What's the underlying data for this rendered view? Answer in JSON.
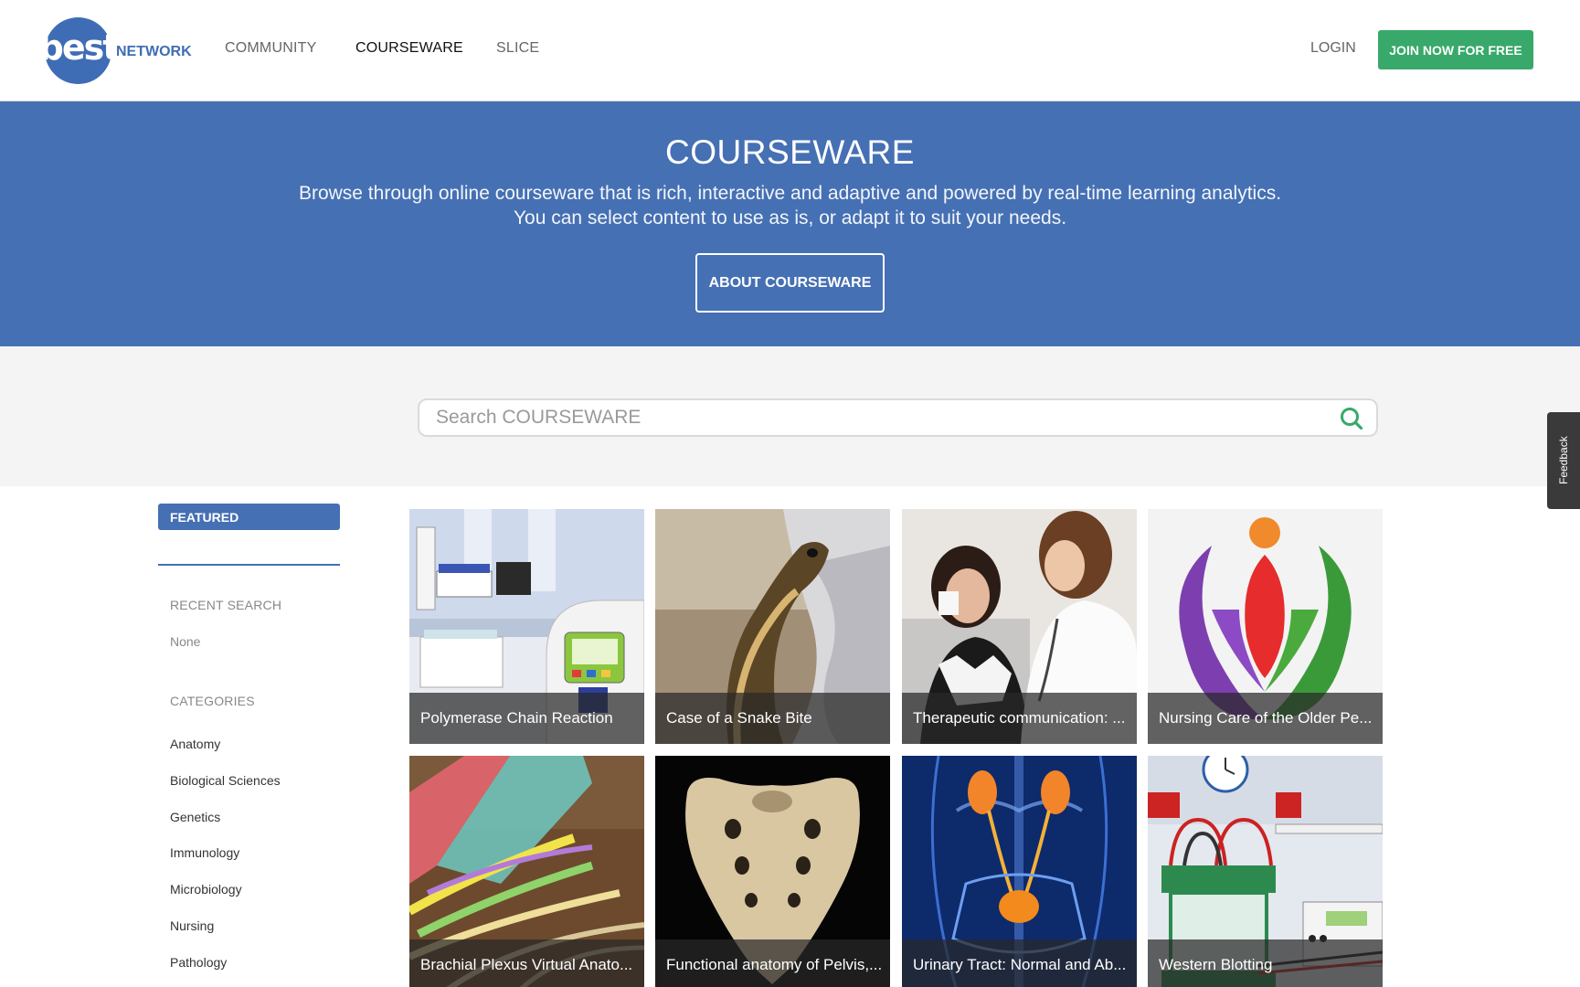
{
  "nav": {
    "logo_text": "best",
    "logo_word": "NETWORK",
    "items": [
      {
        "label": "COMMUNITY"
      },
      {
        "label": "COURSEWARE"
      },
      {
        "label": "SLICE"
      }
    ],
    "active": "COURSEWARE",
    "login_label": "LOGIN",
    "join_label": "JOIN NOW FOR FREE"
  },
  "hero": {
    "title": "COURSEWARE",
    "description_line1": "Browse through online courseware that is rich, interactive and adaptive and powered by real-time learning analytics.",
    "description_line2": "You can select content to use as is, or adapt it to suit your needs.",
    "button_label": "ABOUT COURSEWARE"
  },
  "search": {
    "placeholder": "Search COURSEWARE",
    "value": ""
  },
  "feedback": {
    "label": "Feedback"
  },
  "sidebar": {
    "featured_label": "FEATURED",
    "recent_search_heading": "RECENT SEARCH",
    "recent_search_value": "None",
    "categories_heading": "CATEGORIES",
    "categories": [
      {
        "label": "Anatomy"
      },
      {
        "label": "Biological Sciences"
      },
      {
        "label": "Genetics"
      },
      {
        "label": "Immunology"
      },
      {
        "label": "Microbiology"
      },
      {
        "label": "Nursing"
      },
      {
        "label": "Pathology"
      }
    ]
  },
  "courses": [
    {
      "title": "Polymerase Chain Reaction"
    },
    {
      "title": "Case of a Snake Bite"
    },
    {
      "title": "Therapeutic communication: ..."
    },
    {
      "title": "Nursing Care of the Older Pe..."
    },
    {
      "title": "Brachial Plexus Virtual Anato..."
    },
    {
      "title": "Functional anatomy of Pelvis,..."
    },
    {
      "title": "Urinary Tract: Normal and Ab..."
    },
    {
      "title": "Western Blotting"
    }
  ],
  "colors": {
    "brand_blue": "#4570b3",
    "join_green": "#38a96a",
    "search_icon_green": "#38a96a"
  }
}
